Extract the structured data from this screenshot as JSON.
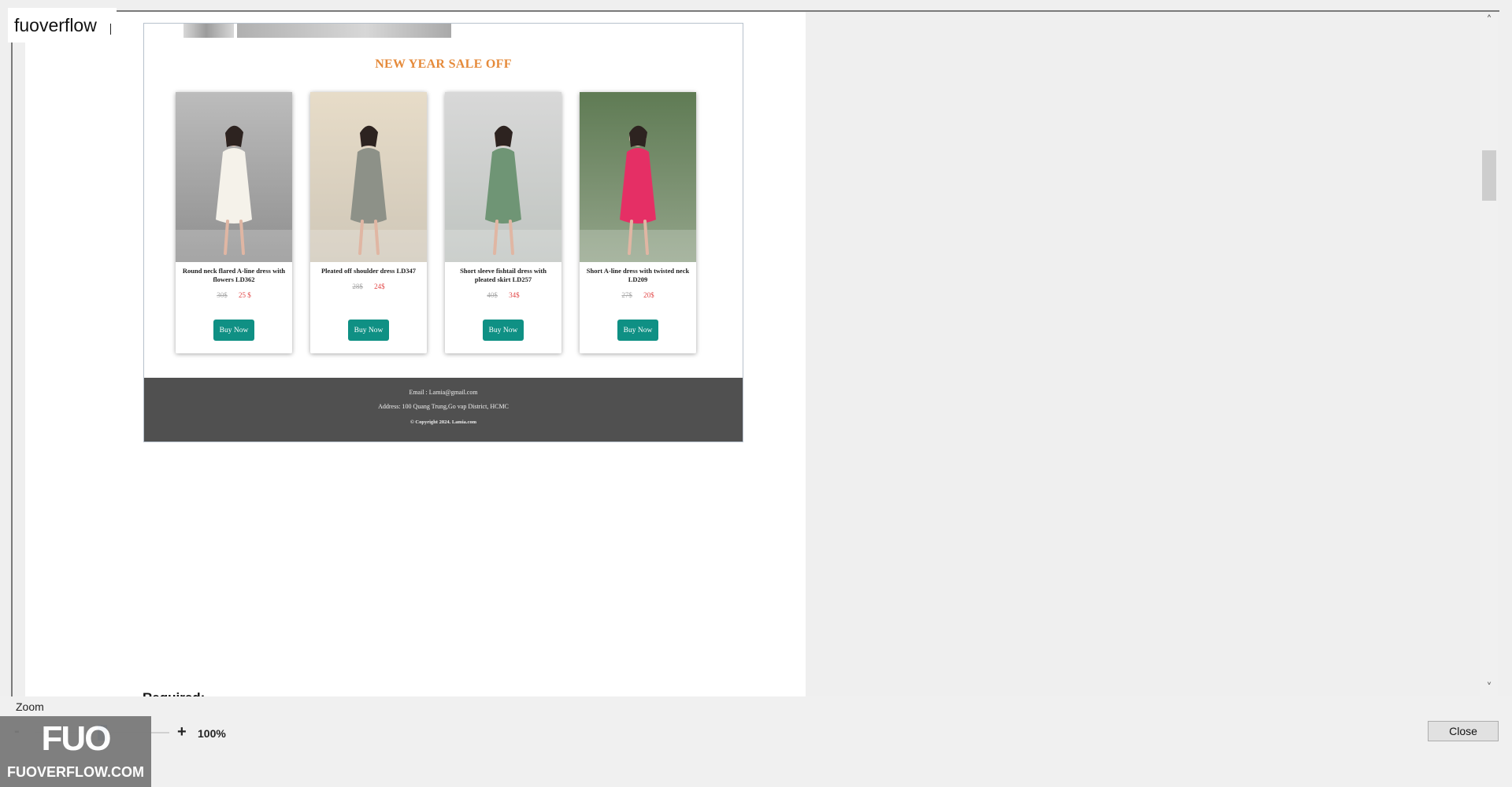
{
  "app": {
    "title": "fuoverflow"
  },
  "preview": {
    "sale_title": "NEW YEAR SALE OFF",
    "products": [
      {
        "name": "Round neck flared A-line dress with flowers LD362",
        "old_price": "30$",
        "new_price": "25 $",
        "button": "Buy Now",
        "colors": {
          "bg1": "#bcbcbc",
          "bg2": "#8f8f8f",
          "dress": "#f5f2ea"
        }
      },
      {
        "name": "Pleated off shoulder dress LD347",
        "old_price": "28$",
        "new_price": "24$",
        "button": "Buy Now",
        "colors": {
          "bg1": "#e7dcc8",
          "bg2": "#cfc7b8",
          "dress": "#8d9188"
        }
      },
      {
        "name": "Short sleeve fishtail dress with pleated skirt LD257",
        "old_price": "40$",
        "new_price": "34$",
        "button": "Buy Now",
        "colors": {
          "bg1": "#d8d8d8",
          "bg2": "#bfc4c0",
          "dress": "#6f9575"
        }
      },
      {
        "name": "Short A-line dress with twisted neck LD209",
        "old_price": "27$",
        "new_price": "20$",
        "button": "Buy Now",
        "colors": {
          "bg1": "#5f7b54",
          "bg2": "#93a48a",
          "dress": "#e52f65"
        }
      }
    ],
    "footer": {
      "email": "Email : Lamia@gmail.com",
      "address": "Address: 100 Quang Trung,Go vap District, HCMC",
      "copyright": "© Copyright 2024. Lamia.com"
    }
  },
  "required_label": "Required:",
  "bottom": {
    "zoom_label": "Zoom",
    "zoom_minus": "-",
    "zoom_plus": "+",
    "zoom_value": "100%",
    "zoom_level": 0.5,
    "close_button": "Close"
  },
  "logo": {
    "mark": "FUO",
    "text": "FUOVERFLOW.COM"
  },
  "icons": {
    "scroll_up": "chevron-up-icon",
    "scroll_down": "chevron-down-icon"
  }
}
